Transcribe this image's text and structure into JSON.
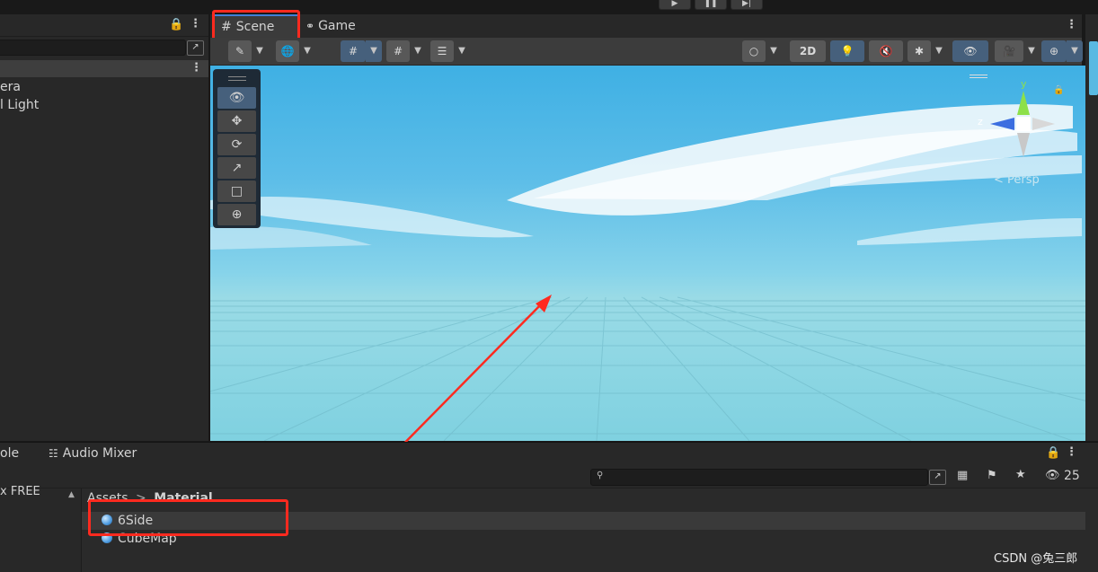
{
  "window": {
    "play_icon": "play-icon",
    "pause_icon": "pause-icon",
    "step_icon": "step-icon"
  },
  "hierarchy": {
    "items": [
      {
        "label": "era"
      },
      {
        "label": "l Light"
      }
    ]
  },
  "scene_tabs": {
    "scene_label": "Scene",
    "game_label": "Game"
  },
  "scene_toolbar": {
    "twod_label": "2D",
    "gizmo_count": ""
  },
  "orientation": {
    "y_label": "y",
    "z_label": "z",
    "projection_label": "< Persp"
  },
  "project": {
    "tabs": [
      {
        "label": "ole"
      },
      {
        "label": "Audio Mixer"
      }
    ],
    "left_item": "x FREE",
    "breadcrumb": {
      "root": "Assets",
      "separator": ">",
      "current": "Material"
    },
    "assets": [
      {
        "name": "6Side"
      },
      {
        "name": "CubeMap"
      }
    ],
    "hidden_count": "25"
  },
  "watermark": "CSDN @兔三郎",
  "colors": {
    "accent_blue": "#3f7fd8",
    "highlight_red": "#ff2a1f",
    "panel_bg": "#282828",
    "toolbar_bg": "#3c3c3c",
    "sky_top": "#3fb0e4",
    "sky_horizon": "#9adbe6"
  }
}
